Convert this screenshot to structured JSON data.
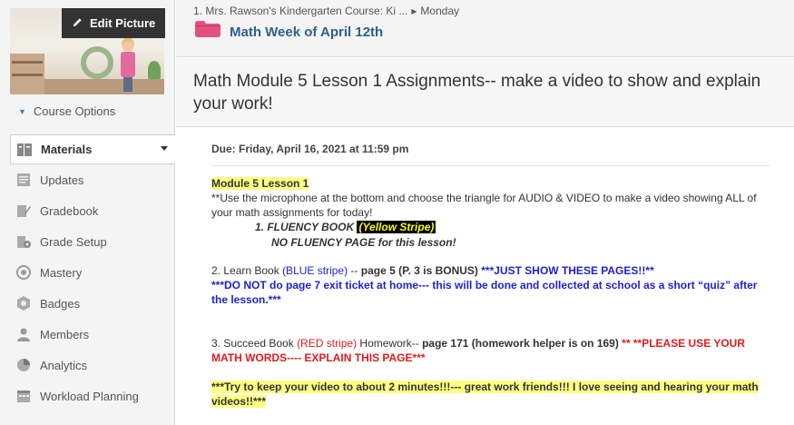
{
  "sidebar": {
    "edit_picture": "Edit Picture",
    "course_options": "Course Options",
    "items": [
      {
        "label": "Materials",
        "icon": "materials-icon"
      },
      {
        "label": "Updates",
        "icon": "updates-icon"
      },
      {
        "label": "Gradebook",
        "icon": "gradebook-icon"
      },
      {
        "label": "Grade Setup",
        "icon": "grade-setup-icon"
      },
      {
        "label": "Mastery",
        "icon": "mastery-icon"
      },
      {
        "label": "Badges",
        "icon": "badges-icon"
      },
      {
        "label": "Members",
        "icon": "members-icon"
      },
      {
        "label": "Analytics",
        "icon": "analytics-icon"
      },
      {
        "label": "Workload Planning",
        "icon": "workload-planning-icon"
      }
    ]
  },
  "header": {
    "breadcrumb_course": "1. Mrs. Rawson's Kindergarten Course: Ki ...",
    "breadcrumb_sep": "▸",
    "breadcrumb_page": "Monday",
    "folder_name": "Math Week of April 12th",
    "folder_color": "#e2527d"
  },
  "assignment": {
    "title": "Math Module 5 Lesson 1 Assignments-- make a video to show and explain your work!",
    "due": "Due: Friday, April 16, 2021 at 11:59 pm"
  },
  "body": {
    "module": "Module 5  Lesson 1",
    "instr1": "**Use the microphone at the bottom and choose the triangle for AUDIO & VIDEO to make a video showing ALL of",
    "instr2": "your math assignments for today!",
    "fluency": "1. FLUENCY BOOK ",
    "fluency_tag": "(Yellow Stripe)",
    "no_fluency": "NO FLUENCY PAGE for this lesson!",
    "learn_a": "2.  Learn Book ",
    "learn_b": "(BLUE stripe)",
    "learn_c": " -- ",
    "learn_d": "page 5  (P. 3 is BONUS)",
    "learn_e": "  ***JUST SHOW THESE PAGES!!**",
    "exit1": "***DO NOT do page 7 exit ticket at home--- this will be done and collected at school as a short “quiz” after",
    "exit2": "the lesson.***",
    "succeed_a": "3. Succeed Book ",
    "succeed_b": "(RED stripe)",
    "succeed_c": " Homework-- ",
    "succeed_d": "page 171  (homework helper is on 169)",
    "succeed_e": " ** **PLEASE USE YOUR",
    "succeed2": "MATH WORDS----  EXPLAIN THIS PAGE***",
    "video1": "***Try to keep your video to about 2 minutes!!!--- great work friends!!!  I love seeing and hearing your math",
    "video2": "videos!!***"
  }
}
